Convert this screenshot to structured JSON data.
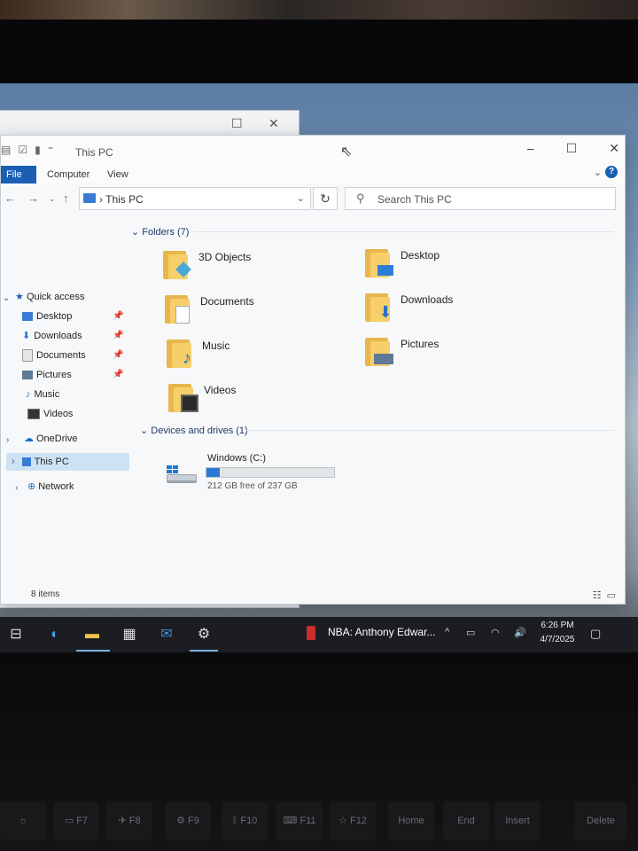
{
  "window": {
    "title": "This PC",
    "ribbon_tabs": [
      "File",
      "Computer",
      "View"
    ],
    "controls": {
      "minimize": "–",
      "maximize": "☐",
      "close": "✕"
    }
  },
  "address": {
    "breadcrumb": "This PC",
    "search_placeholder": "Search This PC"
  },
  "navigation": {
    "quick_access_label": "Quick access",
    "quick_access_items": [
      {
        "label": "Desktop",
        "icon": "desktop-icon",
        "pinned": true
      },
      {
        "label": "Downloads",
        "icon": "downloads-icon",
        "pinned": true
      },
      {
        "label": "Documents",
        "icon": "documents-icon",
        "pinned": true
      },
      {
        "label": "Pictures",
        "icon": "pictures-icon",
        "pinned": true
      },
      {
        "label": "Music",
        "icon": "music-icon",
        "pinned": false
      },
      {
        "label": "Videos",
        "icon": "videos-icon",
        "pinned": false
      }
    ],
    "onedrive_label": "OneDrive",
    "this_pc_label": "This PC",
    "network_label": "Network"
  },
  "folders": {
    "header": "Folders (7)",
    "items": [
      {
        "label": "3D Objects",
        "icon": "3d-objects-icon"
      },
      {
        "label": "Desktop",
        "icon": "desktop-icon"
      },
      {
        "label": "Documents",
        "icon": "documents-icon"
      },
      {
        "label": "Downloads",
        "icon": "downloads-icon"
      },
      {
        "label": "Music",
        "icon": "music-icon"
      },
      {
        "label": "Pictures",
        "icon": "pictures-icon"
      },
      {
        "label": "Videos",
        "icon": "videos-icon"
      }
    ]
  },
  "devices": {
    "header": "Devices and drives (1)",
    "drive": {
      "name": "Windows (C:)",
      "free_text": "212 GB free of 237 GB",
      "used_fraction": 0.105
    }
  },
  "status": {
    "item_count": "8 items"
  },
  "taskbar": {
    "news_text": "NBA: Anthony Edwar...",
    "time": "6:26 PM",
    "date": "4/7/2025"
  },
  "keyboard": {
    "keys": [
      "F7",
      "F8",
      "F9",
      "F10",
      "F11",
      "F12",
      "Home",
      "End",
      "Insert",
      "Delete"
    ]
  },
  "colors": {
    "accent": "#1a5fb4",
    "folder": "#f6cf6a",
    "selection": "#cde3f5"
  }
}
